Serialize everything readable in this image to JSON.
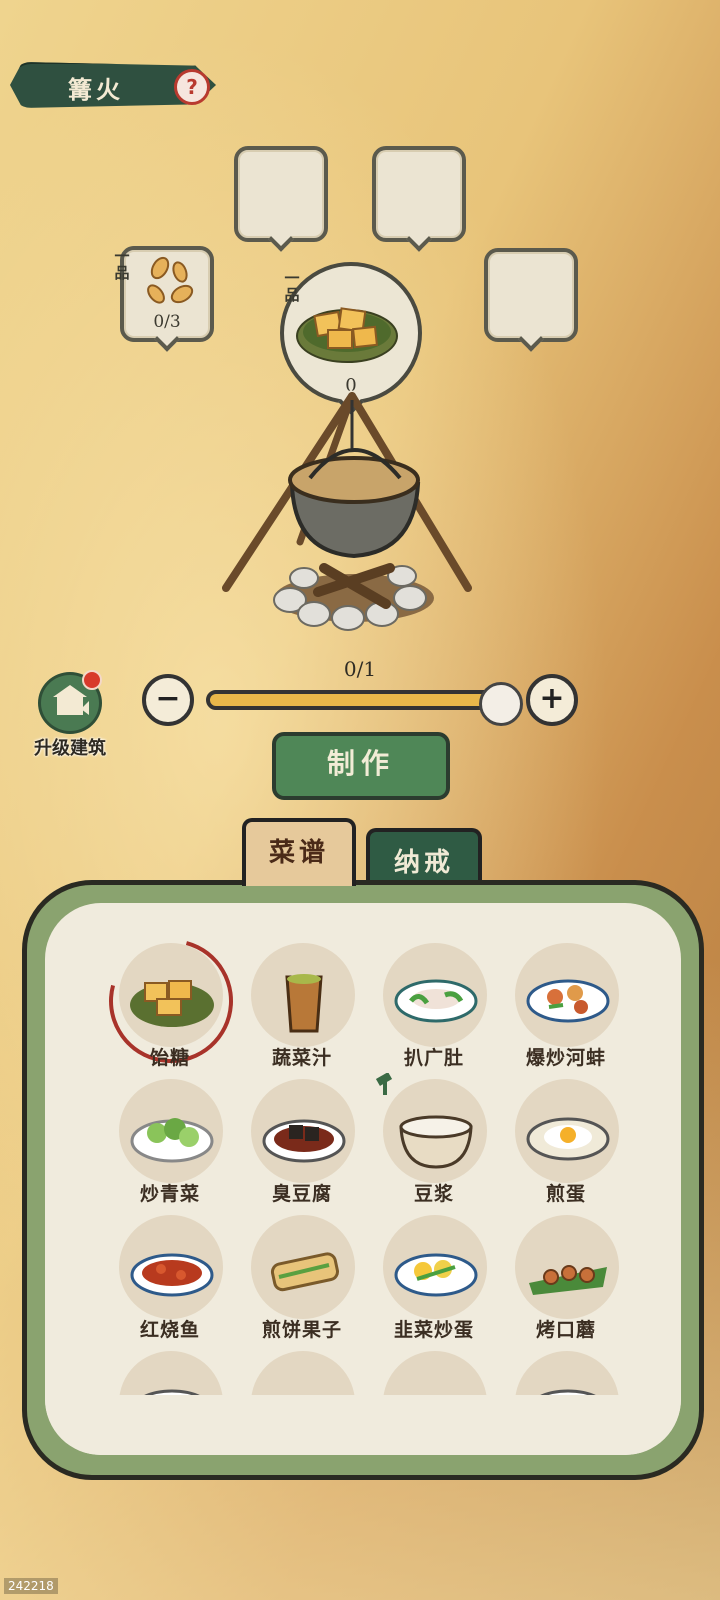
{
  "header": {
    "title": "篝火",
    "help_icon": "question-icon"
  },
  "slots": {
    "left": {
      "grade": "一品",
      "count": "0/3"
    },
    "center": {
      "grade": "一品",
      "count": "0"
    }
  },
  "craft": {
    "progress_text": "0/1",
    "slider_level": 1.0,
    "make_label": "制作",
    "upgrade_label": "升级建筑"
  },
  "tabs": {
    "recipe": "菜谱",
    "ring": "纳戒"
  },
  "recipes": [
    {
      "label": "饴糖"
    },
    {
      "label": "蔬菜汁"
    },
    {
      "label": "扒广肚"
    },
    {
      "label": "爆炒河蚌"
    },
    {
      "label": "炒青菜"
    },
    {
      "label": "臭豆腐"
    },
    {
      "label": "豆浆"
    },
    {
      "label": "煎蛋"
    },
    {
      "label": "红烧鱼"
    },
    {
      "label": "煎饼果子"
    },
    {
      "label": "韭菜炒蛋"
    },
    {
      "label": "烤口蘑"
    }
  ],
  "version": "242218",
  "colors": {
    "accent_green": "#4f8757",
    "dark_green": "#2f5040",
    "selected_ring": "#a8332a"
  }
}
